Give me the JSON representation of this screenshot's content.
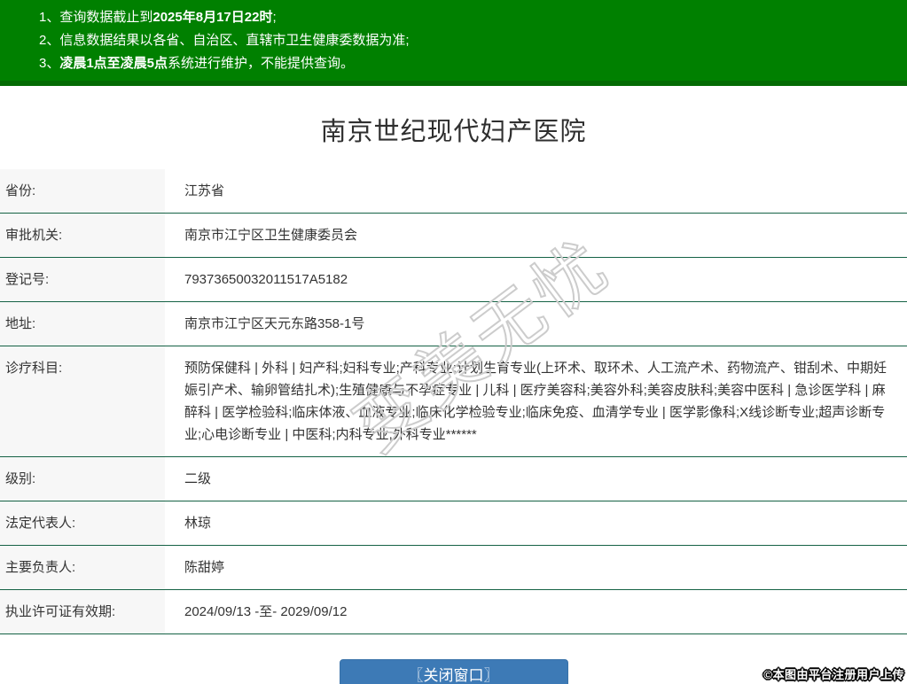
{
  "notice": {
    "items": [
      {
        "num": "1、",
        "pre": "查询数据截止到",
        "bold": "2025年8月17日22时",
        "post": ";"
      },
      {
        "num": "2、",
        "pre": "信息数据结果以各省、自治区、直辖市卫生健康委数据为准;",
        "bold": "",
        "post": ""
      },
      {
        "num": "3、",
        "pre": "",
        "bold": "凌晨1点至凌晨5点",
        "post": "系统进行维护，不能提供查询。"
      }
    ]
  },
  "page": {
    "title": "南京世纪现代妇产医院"
  },
  "table": {
    "rows": [
      {
        "label": "省份:",
        "value": "江苏省"
      },
      {
        "label": "审批机关:",
        "value": "南京市江宁区卫生健康委员会"
      },
      {
        "label": "登记号:",
        "value": "79373650032011517A5182"
      },
      {
        "label": "地址:",
        "value": "南京市江宁区天元东路358-1号"
      },
      {
        "label": "诊疗科目:",
        "value": "预防保健科 | 外科 | 妇产科;妇科专业;产科专业;计划生育专业(上环术、取环术、人工流产术、药物流产、钳刮术、中期妊娠引产术、输卵管结扎术);生殖健康与不孕症专业 | 儿科 | 医疗美容科;美容外科;美容皮肤科;美容中医科 | 急诊医学科 | 麻醉科 | 医学检验科;临床体液、血液专业;临床化学检验专业;临床免疫、血清学专业 | 医学影像科;X线诊断专业;超声诊断专业;心电诊断专业 | 中医科;内科专业;外科专业******"
      },
      {
        "label": "级别:",
        "value": "二级"
      },
      {
        "label": "法定代表人:",
        "value": "林琼"
      },
      {
        "label": "主要负责人:",
        "value": "陈甜婷"
      },
      {
        "label": "执业许可证有效期:",
        "value": "2024/09/13 -至- 2029/09/12"
      }
    ]
  },
  "button": {
    "label": "〖关闭窗口〗"
  },
  "watermark": {
    "text": "变美无忧"
  },
  "credit": {
    "text": "©本图由平台注册用户上传"
  },
  "colors": {
    "header_green": "#008000",
    "header_green_dark": "#046b04",
    "row_border_green": "#156245",
    "label_bg": "#f7f7f7",
    "button_blue": "#3d7ab6"
  }
}
